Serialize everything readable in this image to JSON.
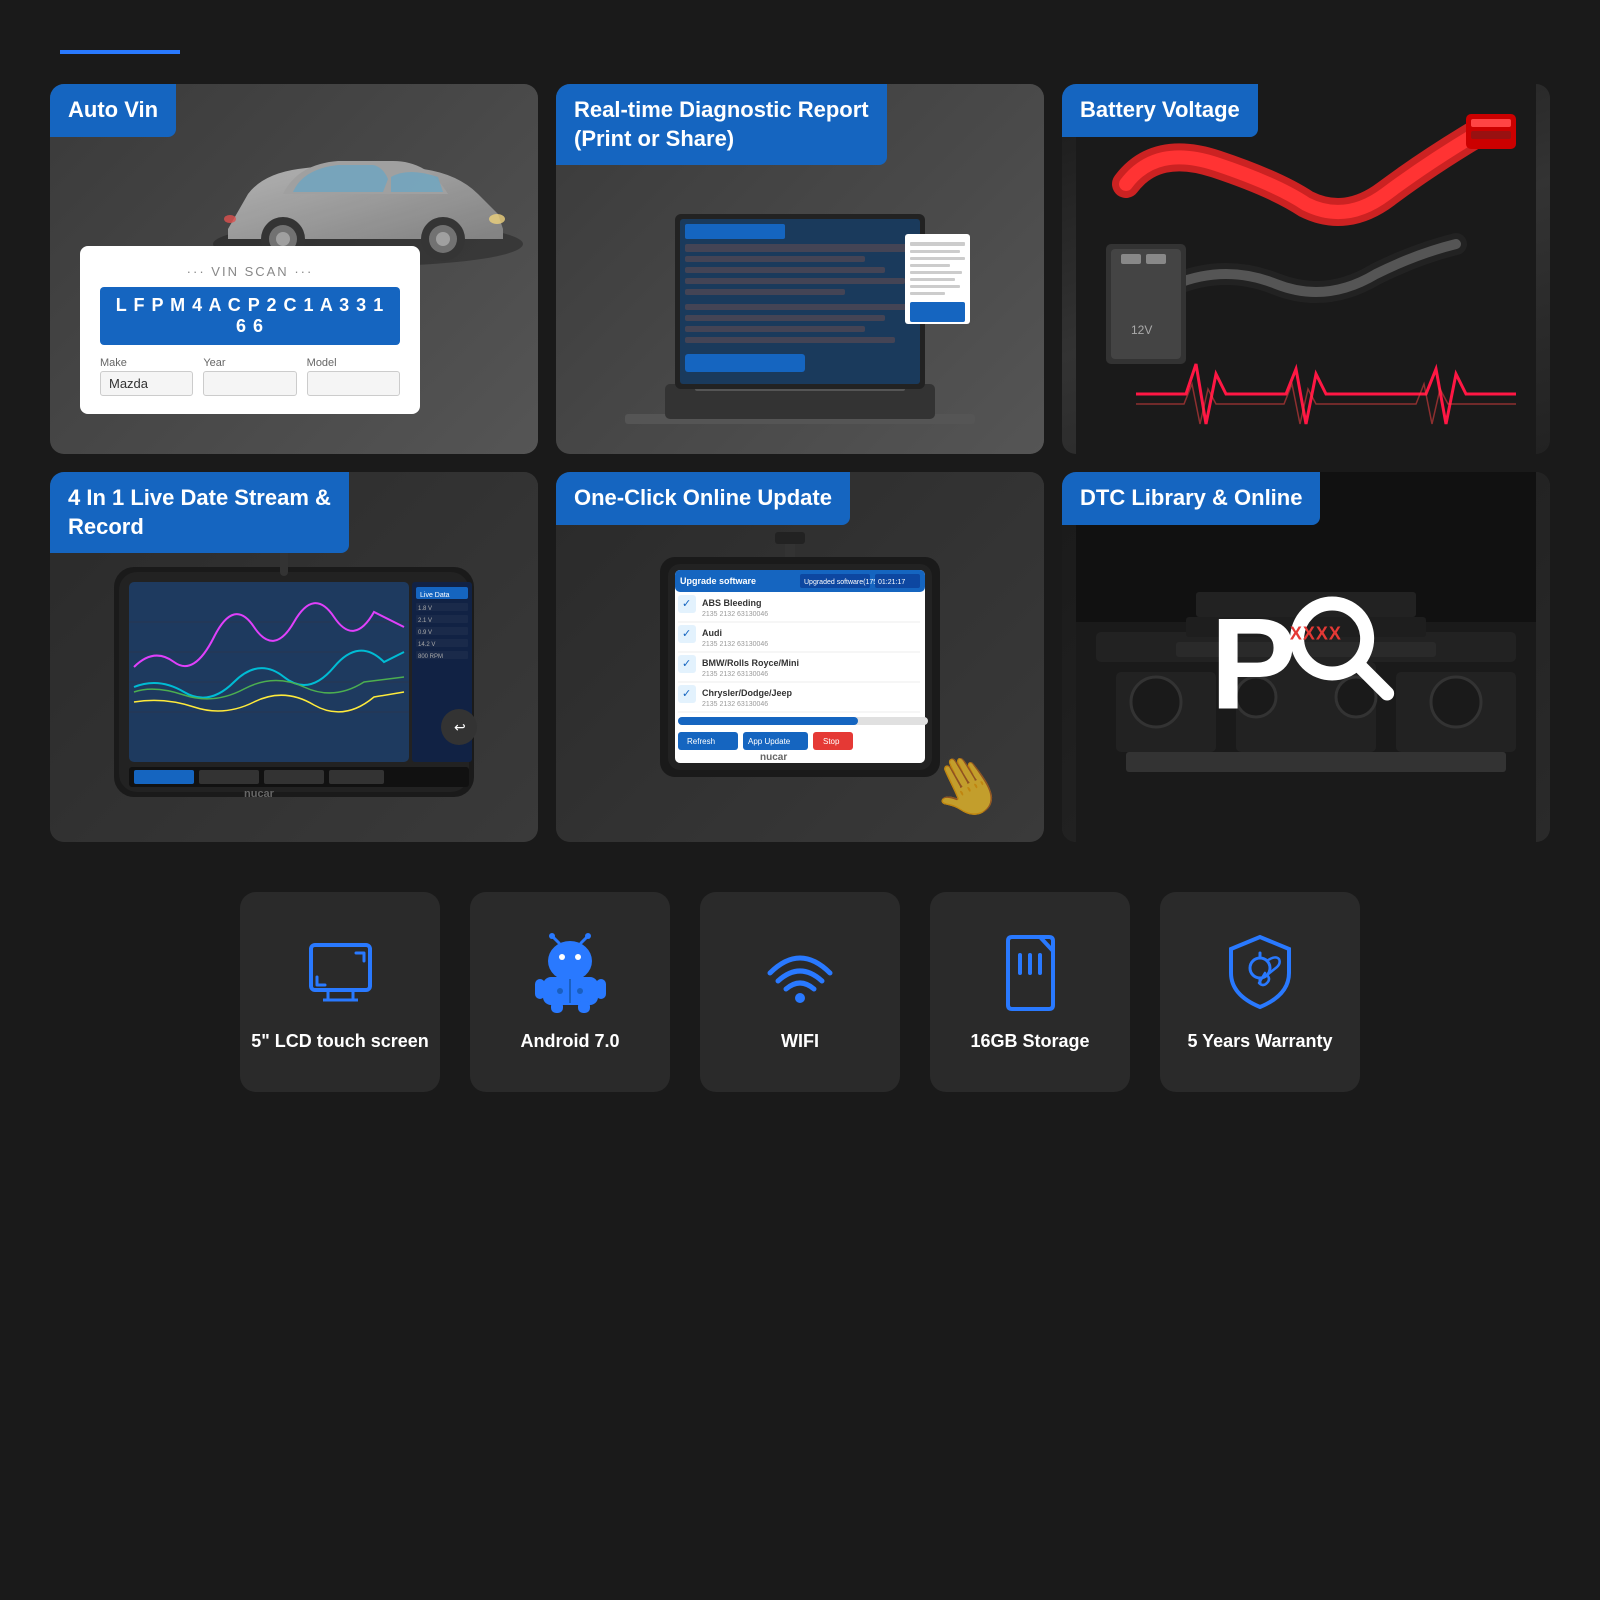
{
  "topLine": {},
  "cards": [
    {
      "id": "auto-vin",
      "label": "Auto Vin",
      "vinLabel": "VIN SCAN",
      "vinNumber": "L F P M 4 A C P 2 C 1 A 3 3 1 6 6",
      "makeLabel": "Make",
      "makeValue": "Mazda",
      "yearLabel": "Year",
      "yearValue": "",
      "modelLabel": "Model",
      "modelValue": ""
    },
    {
      "id": "real-time-report",
      "label": "Real-time Diagnostic Report\n(Print or Share)"
    },
    {
      "id": "battery-voltage",
      "label": "Battery Voltage"
    },
    {
      "id": "live-data-stream",
      "label": "4 In 1 Live Date Stream & Record"
    },
    {
      "id": "one-click-update",
      "label": "One-Click Online Update",
      "updateRows": [
        {
          "name": "ABS Bleeding",
          "detail": "2135 2132 63130046"
        },
        {
          "name": "Audi",
          "detail": "2135 2132 63130046"
        },
        {
          "name": "BMW/Rolls Royce/Mini",
          "detail": "2135 2132 63130046"
        },
        {
          "name": "Chrysler/Dodge/Jeep",
          "detail": "2135 2132 63130046"
        }
      ],
      "buttons": [
        "Refresh",
        "App Update",
        "Stop"
      ]
    },
    {
      "id": "dtc-library",
      "label": "DTC Library & Online",
      "pLetter": "P",
      "xCode": "XXXX"
    }
  ],
  "features": [
    {
      "id": "lcd-screen",
      "icon": "screen-icon",
      "label": "5\" LCD touch screen"
    },
    {
      "id": "android",
      "icon": "android-icon",
      "label": "Android 7.0"
    },
    {
      "id": "wifi",
      "icon": "wifi-icon",
      "label": "WIFI"
    },
    {
      "id": "storage",
      "icon": "storage-icon",
      "label": "16GB Storage"
    },
    {
      "id": "warranty",
      "icon": "warranty-icon",
      "label": "5 Years Warranty"
    }
  ]
}
